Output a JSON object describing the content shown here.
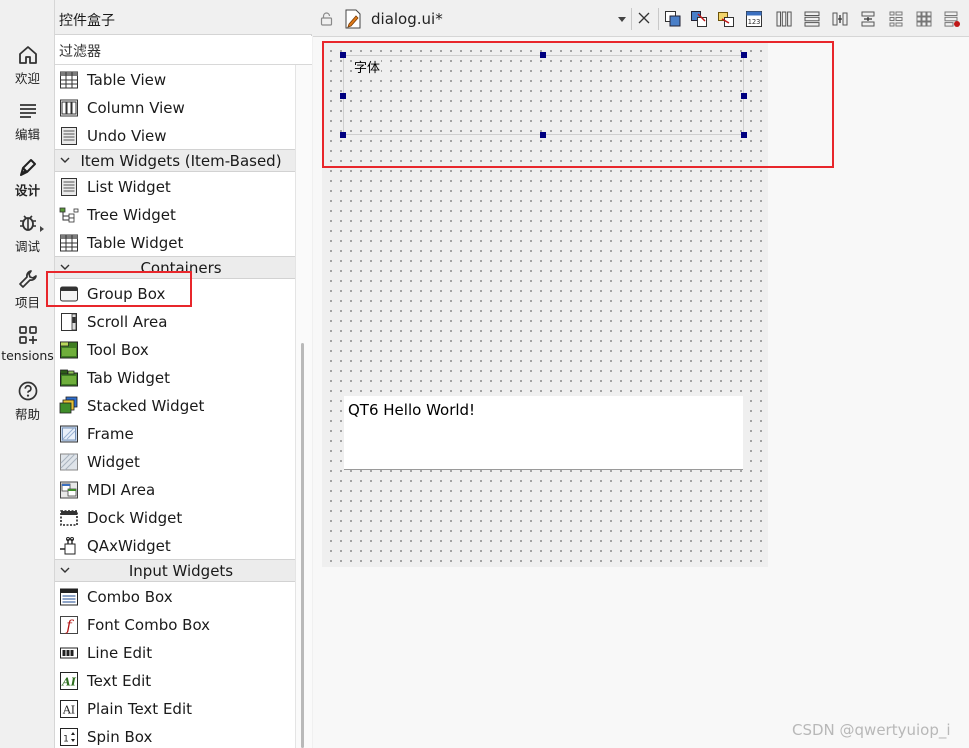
{
  "mode_bar": {
    "items": [
      {
        "label": "欢迎",
        "icon": "home-icon"
      },
      {
        "label": "编辑",
        "icon": "edit-lines-icon"
      },
      {
        "label": "设计",
        "icon": "design-pen-icon"
      },
      {
        "label": "调试",
        "icon": "debug-bug-icon"
      },
      {
        "label": "项目",
        "icon": "wrench-icon"
      },
      {
        "label": "tensions",
        "icon": "extensions-grid-icon"
      },
      {
        "label": "帮助",
        "icon": "help-icon"
      }
    ],
    "active": "设计"
  },
  "widget_box": {
    "title": "控件盒子",
    "filter_placeholder": "过滤器",
    "items": [
      {
        "kind": "item",
        "label": "Table View",
        "icon": "table-view-icon"
      },
      {
        "kind": "item",
        "label": "Column View",
        "icon": "column-view-icon"
      },
      {
        "kind": "item",
        "label": "Undo View",
        "icon": "undo-view-icon"
      },
      {
        "kind": "category",
        "label": "Item Widgets (Item-Based)"
      },
      {
        "kind": "item",
        "label": "List Widget",
        "icon": "list-widget-icon"
      },
      {
        "kind": "item",
        "label": "Tree Widget",
        "icon": "tree-widget-icon"
      },
      {
        "kind": "item",
        "label": "Table Widget",
        "icon": "table-widget-icon"
      },
      {
        "kind": "category",
        "label": "Containers"
      },
      {
        "kind": "item",
        "label": "Group Box",
        "icon": "group-box-icon"
      },
      {
        "kind": "item",
        "label": "Scroll Area",
        "icon": "scroll-area-icon"
      },
      {
        "kind": "item",
        "label": "Tool Box",
        "icon": "tool-box-icon"
      },
      {
        "kind": "item",
        "label": "Tab Widget",
        "icon": "tab-widget-icon"
      },
      {
        "kind": "item",
        "label": "Stacked Widget",
        "icon": "stacked-widget-icon"
      },
      {
        "kind": "item",
        "label": "Frame",
        "icon": "frame-icon"
      },
      {
        "kind": "item",
        "label": "Widget",
        "icon": "widget-icon"
      },
      {
        "kind": "item",
        "label": "MDI Area",
        "icon": "mdi-area-icon"
      },
      {
        "kind": "item",
        "label": "Dock Widget",
        "icon": "dock-widget-icon"
      },
      {
        "kind": "item",
        "label": "QAxWidget",
        "icon": "qaxwidget-icon"
      },
      {
        "kind": "category",
        "label": "Input Widgets"
      },
      {
        "kind": "item",
        "label": "Combo Box",
        "icon": "combo-box-icon"
      },
      {
        "kind": "item",
        "label": "Font Combo Box",
        "icon": "font-combo-box-icon"
      },
      {
        "kind": "item",
        "label": "Line Edit",
        "icon": "line-edit-icon"
      },
      {
        "kind": "item",
        "label": "Text Edit",
        "icon": "text-edit-icon"
      },
      {
        "kind": "item",
        "label": "Plain Text Edit",
        "icon": "plain-text-edit-icon"
      },
      {
        "kind": "item",
        "label": "Spin Box",
        "icon": "spin-box-icon"
      }
    ]
  },
  "editor": {
    "filename": "dialog.ui*",
    "toolbar_icons": [
      "edit-widgets-icon",
      "edit-signals-slots-icon",
      "edit-buddies-icon",
      "edit-tab-order-icon",
      "layout-horizontal-icon",
      "layout-vertical-icon",
      "layout-horizontal-splitter-icon",
      "layout-vertical-splitter-icon",
      "layout-form-icon",
      "layout-grid-icon",
      "break-layout-icon"
    ],
    "form": {
      "group_box_title": "字体",
      "label_text": "QT6 Hello World!"
    }
  },
  "colors": {
    "annotation": "#e8262b",
    "selection_handle": "#000080"
  },
  "watermark": "CSDN @qwertyuiop_i"
}
